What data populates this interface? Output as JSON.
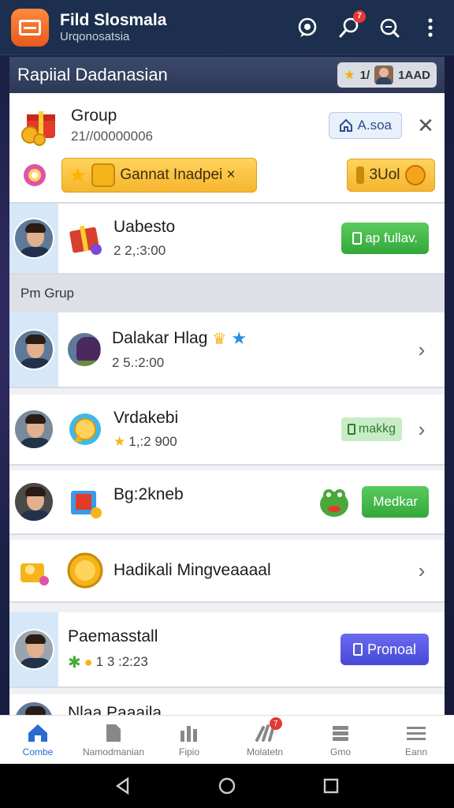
{
  "app": {
    "title": "Fild Slosmala",
    "subtitle": "Urqonosatsia",
    "notification_badge": "7"
  },
  "section": {
    "title": "Rapiial Dadanasian",
    "chip_text": "1/",
    "chip_right": "1AAD"
  },
  "top_card": {
    "title": "Group",
    "subtitle": "21//00000006",
    "button_label": "A.soa",
    "pill_label": "Gannat Inadpei ×",
    "coins_label": "3Uol"
  },
  "rows": [
    {
      "title": "Uabesto",
      "subtitle": "2 2,:3:00",
      "action": "ap fullav."
    },
    {
      "title": "Dalakar Hlag",
      "subtitle": "2 5.:2:00"
    },
    {
      "title": "Vrdakebi",
      "subtitle": "1,:2 900",
      "action": "makkg"
    },
    {
      "title": "Bg:2kneb",
      "action": "Medkar"
    },
    {
      "title": "Hadikali Mingveaaaal"
    },
    {
      "title": "Paemasstall",
      "subtitle": "1 3 :2:23",
      "action": "Pronoal"
    },
    {
      "title": "Nlaa Paaaila"
    }
  ],
  "group_label": "Pm Grup",
  "nav": [
    {
      "label": "Combe",
      "icon": "home-icon"
    },
    {
      "label": "Namodmanian",
      "icon": "document-icon"
    },
    {
      "label": "Fipio",
      "icon": "chart-icon"
    },
    {
      "label": "Molatetn",
      "icon": "tools-icon",
      "badge": "7"
    },
    {
      "label": "Gmo",
      "icon": "stack-icon"
    },
    {
      "label": "Eann",
      "icon": "menu-icon"
    }
  ]
}
